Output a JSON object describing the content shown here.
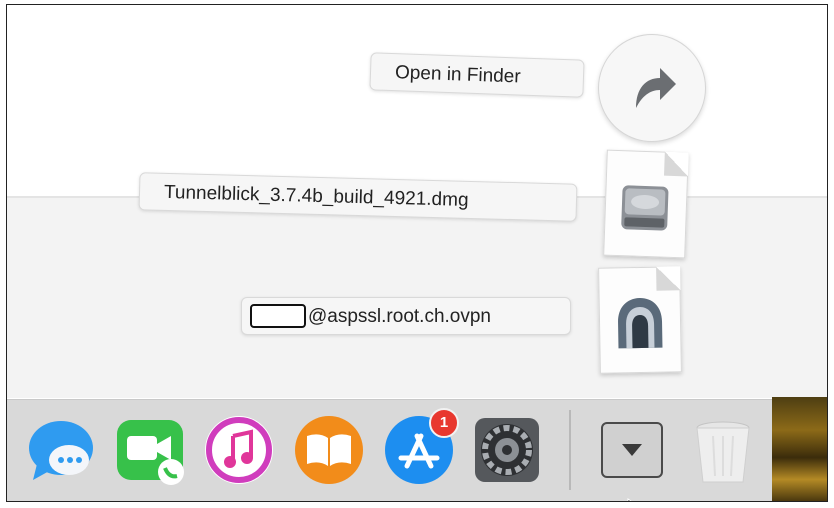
{
  "stack_popup": {
    "open_in_finder_label": "Open in Finder",
    "items": [
      {
        "filename": "Tunnelblick_3.7.4b_build_4921.dmg",
        "icon": "disk-image-icon"
      },
      {
        "filename": "@aspssl.root.ch.ovpn",
        "icon": "tunnelblick-config-icon",
        "redacted_prefix": true
      }
    ]
  },
  "dock": {
    "apps": [
      {
        "name": "Messages",
        "icon": "messages-icon"
      },
      {
        "name": "FaceTime",
        "icon": "facetime-icon"
      },
      {
        "name": "iTunes",
        "icon": "itunes-icon"
      },
      {
        "name": "iBooks",
        "icon": "ibooks-icon"
      },
      {
        "name": "App Store",
        "icon": "app-store-icon",
        "badge": "1"
      },
      {
        "name": "System Preferences",
        "icon": "system-preferences-icon"
      }
    ],
    "stack_icon": "chevron-down-icon",
    "trash_icon": "trash-icon"
  },
  "colors": {
    "badge": "#e8382f",
    "messages": "#2f9bf0",
    "facetime": "#37c14a",
    "ibooks": "#f28c1a",
    "app_store": "#1d8ef0"
  }
}
